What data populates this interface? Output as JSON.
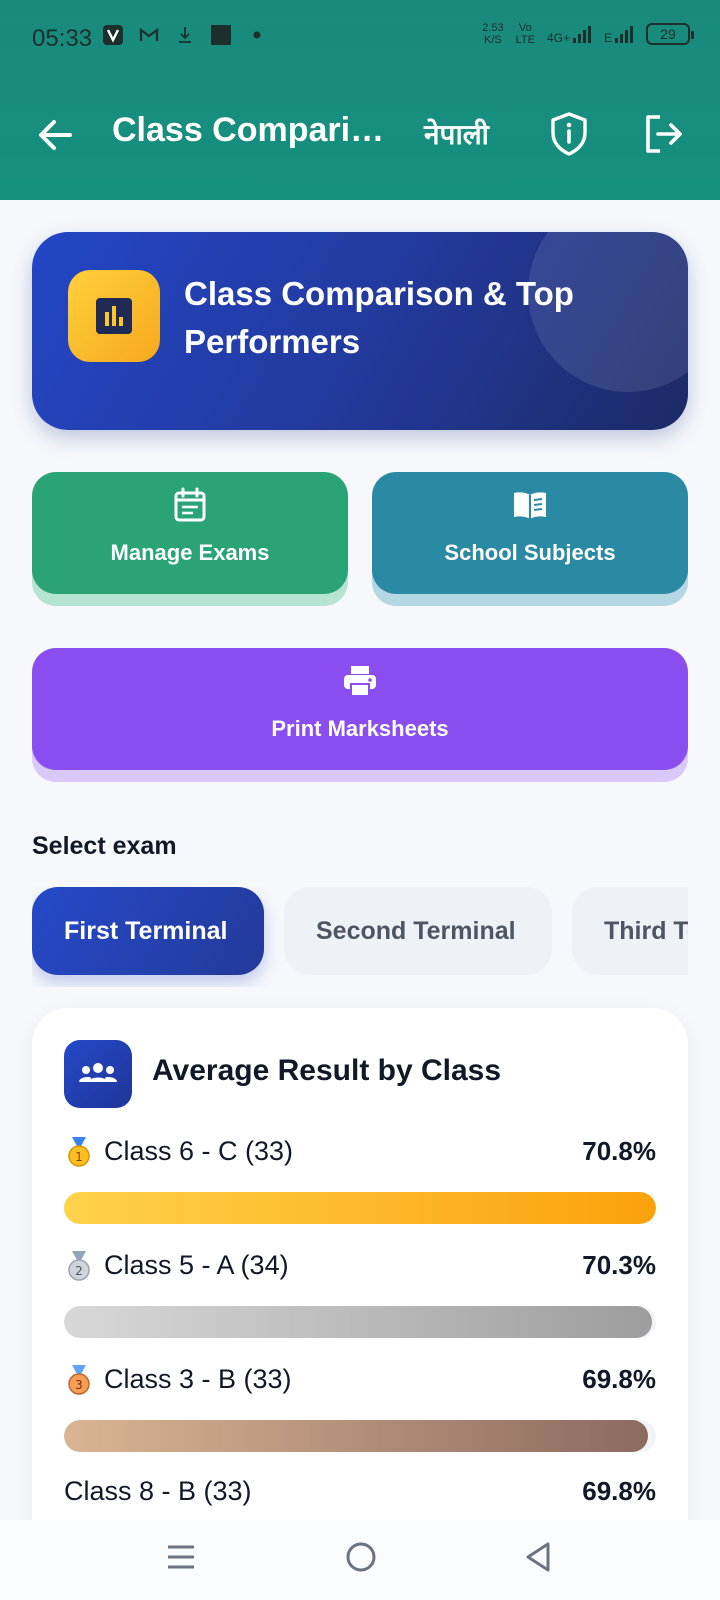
{
  "status_bar": {
    "time": "05:33",
    "net_speed_value": "2.53",
    "net_speed_unit": "K/S",
    "carrier_1_top": "Vo",
    "carrier_1_bottom": "LTE",
    "network_1": "4G+",
    "network_2": "E",
    "battery": "29"
  },
  "app_bar": {
    "title": "Class Comparison & Top Performers",
    "language_toggle": "नेपाली",
    "back_icon": "arrow-left-icon",
    "privacy_icon": "shield-info-icon",
    "logout_icon": "logout-icon"
  },
  "hero": {
    "title": "Class Comparison & Top Performers",
    "icon": "bar-chart-icon"
  },
  "actions": {
    "manage_exams": {
      "label": "Manage Exams",
      "icon": "calendar-icon"
    },
    "school_subjects": {
      "label": "School Subjects",
      "icon": "book-icon"
    },
    "print_marksheets": {
      "label": "Print Marksheets",
      "icon": "printer-icon"
    }
  },
  "exam_selector": {
    "label": "Select exam",
    "options": [
      "First Terminal",
      "Second Terminal",
      "Third Terminal"
    ],
    "selected": "First Terminal"
  },
  "average_results": {
    "title": "Average Result by Class",
    "icon": "group-icon",
    "rows": [
      {
        "medal": "gold",
        "name": "Class 6 - C (33)",
        "percent_label": "70.8%",
        "percent": 70.8,
        "fill_fraction": 1.0
      },
      {
        "medal": "silver",
        "name": "Class 5 - A (34)",
        "percent_label": "70.3%",
        "percent": 70.3,
        "fill_fraction": 0.993
      },
      {
        "medal": "bronze",
        "name": "Class 3 - B (33)",
        "percent_label": "69.8%",
        "percent": 69.8,
        "fill_fraction": 0.986
      },
      {
        "medal": "",
        "name": "Class 8 - B (33)",
        "percent_label": "69.8%",
        "percent": 69.8,
        "fill_fraction": 0.986
      }
    ]
  },
  "system_nav": {
    "menu_icon": "menu-icon",
    "home_icon": "home-circle-icon",
    "back_icon": "triangle-back-icon"
  },
  "colors": {
    "header": "#15907f",
    "primary": "#2549c8",
    "manage": "#2aa377",
    "subjects": "#2b8aa3",
    "print": "#8a4ef0",
    "gold": "#fba10c"
  }
}
